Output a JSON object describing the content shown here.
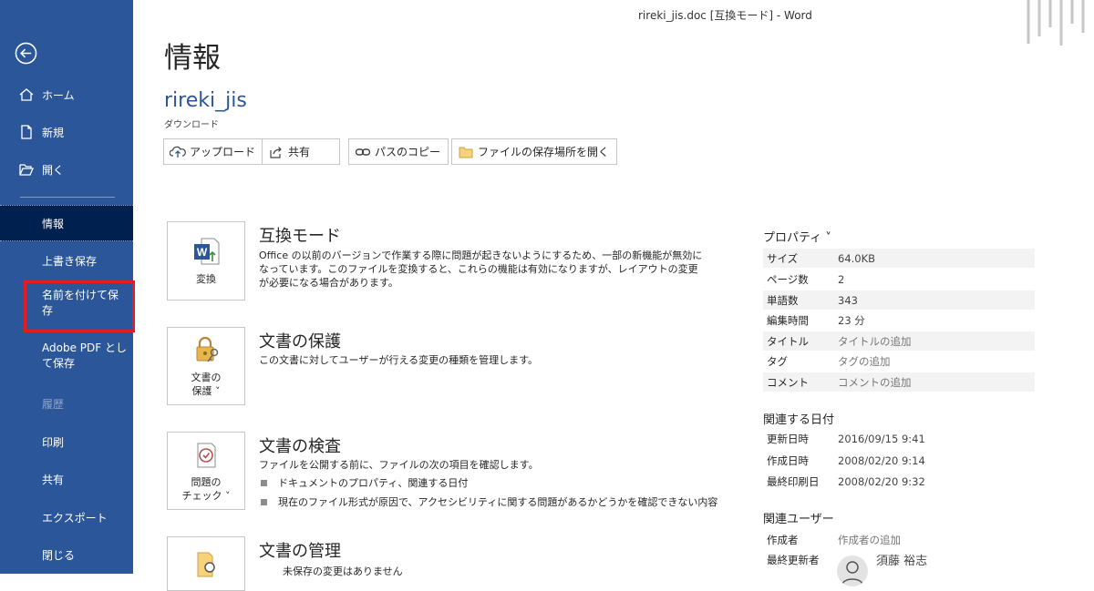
{
  "window": {
    "title": "rireki_jis.doc [互換モード]  -  Word"
  },
  "sidebar": {
    "items": [
      {
        "label": "ホーム"
      },
      {
        "label": "新規"
      },
      {
        "label": "開く"
      },
      {
        "label": "情報"
      },
      {
        "label": "上書き保存"
      },
      {
        "label": "名前を付けて保存"
      },
      {
        "label": "Adobe PDF として保存"
      },
      {
        "label": "履歴"
      },
      {
        "label": "印刷"
      },
      {
        "label": "共有"
      },
      {
        "label": "エクスポート"
      },
      {
        "label": "閉じる"
      }
    ],
    "saveas_lines": [
      "名前を付けて保",
      "存"
    ],
    "pdf_lines": [
      "Adobe PDF とし",
      "て保存"
    ]
  },
  "main": {
    "title": "情報",
    "doc_name": "rireki_jis",
    "doc_location": "ダウンロード",
    "actions": [
      {
        "label": "アップロード",
        "icon": "upload-icon"
      },
      {
        "label": "共有",
        "icon": "share-icon"
      },
      {
        "label": "パスのコピー",
        "icon": "link-icon"
      },
      {
        "label": "ファイルの保存場所を開く",
        "icon": "folder-icon"
      }
    ],
    "sections": [
      {
        "button_lines": [
          "変換"
        ],
        "title": "互換モード",
        "desc": "Office の以前のバージョンで作業する際に問題が起きないようにするため、一部の新機能が無効になっています。このファイルを変換すると、これらの機能は有効になりますが、レイアウトの変更が必要になる場合があります。"
      },
      {
        "button_lines": [
          "文書の",
          "保護 ˅"
        ],
        "title": "文書の保護",
        "desc": "この文書に対してユーザーが行える変更の種類を管理します。"
      },
      {
        "button_lines": [
          "問題の",
          "チェック ˅"
        ],
        "title": "文書の検査",
        "desc": "ファイルを公開する前に、ファイルの次の項目を確認します。",
        "bullets": [
          "ドキュメントのプロパティ、関連する日付",
          "現在のファイル形式が原因で、アクセシビリティに関する問題があるかどうかを確認できない内容"
        ]
      },
      {
        "title": "文書の管理",
        "desc": "未保存の変更はありません"
      }
    ]
  },
  "properties": {
    "heading": "プロパティ ˅",
    "rows": [
      {
        "label": "サイズ",
        "value": "64.0KB"
      },
      {
        "label": "ページ数",
        "value": "2"
      },
      {
        "label": "単語数",
        "value": "343"
      },
      {
        "label": "編集時間",
        "value": "23 分"
      },
      {
        "label": "タイトル",
        "value": "タイトルの追加"
      },
      {
        "label": "タグ",
        "value": "タグの追加"
      },
      {
        "label": "コメント",
        "value": "コメントの追加"
      }
    ],
    "dates_heading": "関連する日付",
    "dates": [
      {
        "label": "更新日時",
        "value": "2016/09/15 9:41"
      },
      {
        "label": "作成日時",
        "value": "2008/02/20 9:14"
      },
      {
        "label": "最終印刷日",
        "value": "2008/02/20 9:32"
      }
    ],
    "users_heading": "関連ユーザー",
    "users": [
      {
        "label": "作成者",
        "value": "作成者の追加"
      },
      {
        "label": "最終更新者",
        "value": "須藤 裕志"
      }
    ]
  },
  "colors": {
    "sidebar": "#2b579a",
    "selected": "#002050",
    "highlight": "#e21c23",
    "accent": "#2b579a"
  }
}
